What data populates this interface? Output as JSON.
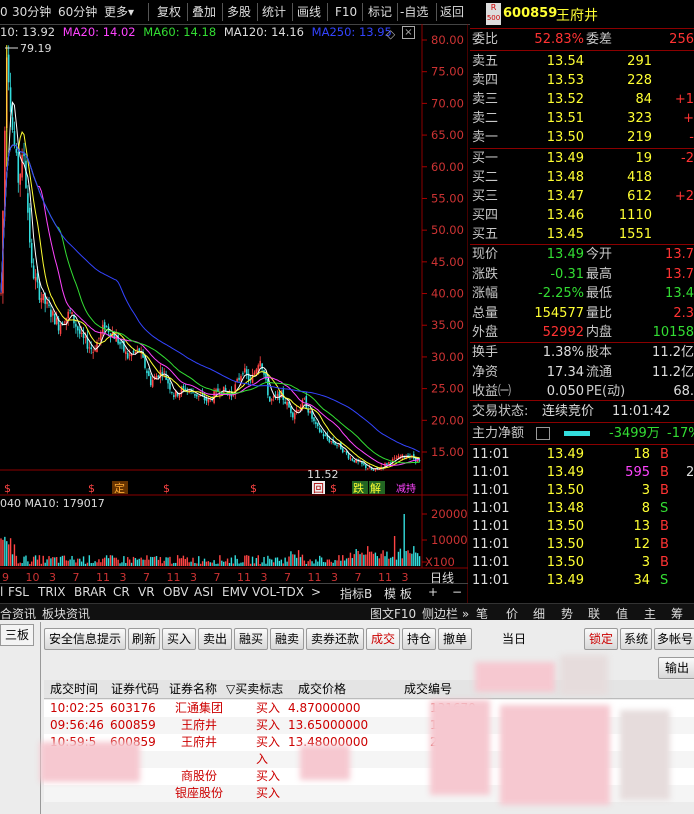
{
  "toolbar": {
    "items": [
      "0",
      "30分钟",
      "60分钟",
      "更多▾",
      "复权",
      "叠加",
      "多股",
      "统计",
      "画线",
      "F10",
      "标记",
      "-自选",
      "返回"
    ]
  },
  "chart": {
    "ma_legend": {
      "ma10": "10: 13.92",
      "ma20": "MA20: 14.02",
      "ma60": "MA60: 14.18",
      "ma120": "MA120: 14.16",
      "ma250": "MA250: 13.95"
    },
    "high_label": "79.19",
    "low_label": "11.52",
    "y_ticks": [
      "80.00",
      "75.00",
      "70.00",
      "65.00",
      "60.00",
      "55.00",
      "50.00",
      "45.00",
      "40.00",
      "35.00",
      "30.00",
      "25.00",
      "20.00",
      "15.00"
    ],
    "vol_legend": "040 MA10: 179017",
    "vol_ticks": [
      "20000",
      "10000",
      "X100"
    ],
    "x_ticks": [
      "9",
      "10",
      "3",
      "7",
      "11",
      "3",
      "7",
      "11",
      "3",
      "7",
      "11",
      "3",
      "7",
      "11",
      "3",
      "7",
      "11",
      "3"
    ],
    "markers": [
      "$",
      "定",
      "$",
      "$",
      "$",
      "$"
    ],
    "bottom_markers": [
      "回",
      "$",
      "跌",
      "解",
      "减持"
    ]
  },
  "indicator_tabs": [
    "FSL",
    "TRIX",
    "BRAR",
    "CR",
    "VR",
    "OBV",
    "ASI",
    "EMV",
    "VOL-TDX",
    ">"
  ],
  "indicator_right": [
    "指标B",
    "模 板",
    "+",
    "−"
  ],
  "date_line": "日线",
  "info_tabs": [
    "合资讯",
    "板块资讯"
  ],
  "quote": {
    "badge_top": "R",
    "badge_bottom": "500",
    "code": "600859",
    "name": "王府井",
    "weibi_label": "委比",
    "weibi": "52.83%",
    "weicha_label": "委差",
    "weicha": "256",
    "asks": [
      {
        "label": "卖五",
        "price": "13.54",
        "vol": "291",
        "chg": ""
      },
      {
        "label": "卖四",
        "price": "13.53",
        "vol": "228",
        "chg": ""
      },
      {
        "label": "卖三",
        "price": "13.52",
        "vol": "84",
        "chg": "+1"
      },
      {
        "label": "卖二",
        "price": "13.51",
        "vol": "323",
        "chg": "+"
      },
      {
        "label": "卖一",
        "price": "13.50",
        "vol": "219",
        "chg": "-"
      }
    ],
    "bids": [
      {
        "label": "买一",
        "price": "13.49",
        "vol": "19",
        "chg": "-2"
      },
      {
        "label": "买二",
        "price": "13.48",
        "vol": "418",
        "chg": ""
      },
      {
        "label": "买三",
        "price": "13.47",
        "vol": "612",
        "chg": "+2"
      },
      {
        "label": "买四",
        "price": "13.46",
        "vol": "1110",
        "chg": ""
      },
      {
        "label": "买五",
        "price": "13.45",
        "vol": "1551",
        "chg": ""
      }
    ],
    "stats": [
      {
        "l1": "现价",
        "v1": "13.49",
        "l2": "今开",
        "v2": "13.7"
      },
      {
        "l1": "涨跌",
        "v1": "-0.31",
        "l2": "最高",
        "v2": "13.7"
      },
      {
        "l1": "涨幅",
        "v1": "-2.25%",
        "l2": "最低",
        "v2": "13.4"
      },
      {
        "l1": "总量",
        "v1": "154577",
        "l2": "量比",
        "v2": "2.3"
      },
      {
        "l1": "外盘",
        "v1": "52992",
        "l2": "内盘",
        "v2": "10158"
      }
    ],
    "stats2": [
      {
        "l1": "换手",
        "v1": "1.38%",
        "l2": "股本",
        "v2": "11.2亿"
      },
      {
        "l1": "净资",
        "v1": "17.34",
        "l2": "流通",
        "v2": "11.2亿"
      },
      {
        "l1": "收益㈠",
        "v1": "0.050",
        "l2": "PE(动)",
        "v2": "68."
      }
    ],
    "trade_state_label": "交易状态:",
    "trade_state": "连续竞价",
    "trade_time": "11:01:42",
    "main_net_label": "主力净额",
    "main_net": "-3499万",
    "main_net_pct": "-17%",
    "ticks": [
      {
        "t": "11:01",
        "p": "13.49",
        "v": "18",
        "s": "B",
        "x": ""
      },
      {
        "t": "11:01",
        "p": "13.49",
        "v": "595",
        "s": "B",
        "x": "2"
      },
      {
        "t": "11:01",
        "p": "13.50",
        "v": "3",
        "s": "B",
        "x": ""
      },
      {
        "t": "11:01",
        "p": "13.48",
        "v": "8",
        "s": "S",
        "x": ""
      },
      {
        "t": "11:01",
        "p": "13.50",
        "v": "13",
        "s": "B",
        "x": ""
      },
      {
        "t": "11:01",
        "p": "13.50",
        "v": "12",
        "s": "B",
        "x": ""
      },
      {
        "t": "11:01",
        "p": "13.50",
        "v": "3",
        "s": "B",
        "x": ""
      },
      {
        "t": "11:01",
        "p": "13.49",
        "v": "34",
        "s": "S",
        "x": ""
      }
    ]
  },
  "right_tabs": [
    "图文F10",
    "侧边栏 »",
    "笔",
    "价",
    "细",
    "势",
    "联",
    "值",
    "主",
    "筹"
  ],
  "trade": {
    "left_tab": "三板",
    "buttons": [
      "安全信息提示",
      "刷新",
      "买入",
      "卖出",
      "融买",
      "融卖",
      "卖券还款",
      "成交",
      "持仓",
      "撤单"
    ],
    "date_label": "当日",
    "right_buttons": [
      "锁定",
      "系统",
      "多帐号"
    ],
    "export": "输出",
    "headers": [
      "成交时间",
      "证券代码",
      "证券名称",
      "▽买卖标志",
      "成交价格",
      "成交编号"
    ],
    "rows": [
      {
        "time": "10:02:25",
        "code": "603176",
        "name": "汇通集团",
        "side": "买入",
        "price": "4.87000000",
        "no": "131670"
      },
      {
        "time": "09:56:46",
        "code": "600859",
        "name": "王府井",
        "side": "买入",
        "price": "13.65000000",
        "no": "115307"
      },
      {
        "time": "10:59:5",
        "code": "600859",
        "name": "王府井",
        "side": "买入",
        "price": "13.48000000",
        "no": "2524"
      },
      {
        "time": "",
        "code": "",
        "name": "",
        "side": "入",
        "price": "",
        "no": ""
      },
      {
        "time": "",
        "code": "",
        "name": "商股份",
        "side": "买入",
        "price": "",
        "no": ""
      },
      {
        "time": "",
        "code": "",
        "name": "银座股份",
        "side": "买入",
        "price": "",
        "no": ""
      }
    ]
  }
}
